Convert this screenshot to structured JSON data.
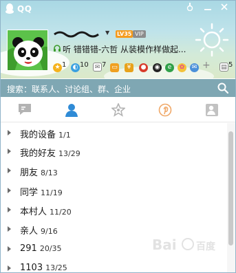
{
  "titlebar": {
    "app_title": "QQ",
    "buttons": [
      "skin",
      "minimize",
      "close"
    ]
  },
  "profile": {
    "nickname": "⁠⁠⁠⁠⁠⁠⁠",
    "level_badge": "LV35",
    "vip_badge": "VIP",
    "signature": "听 错错错-六哲  从装模作样做起..."
  },
  "status_icons": [
    {
      "icon": "star-icon",
      "count": "1",
      "color": "#f5b21c"
    },
    {
      "icon": "qzone-icon",
      "count": "10",
      "color": "#3aa0e0"
    },
    {
      "icon": "mail-icon",
      "count": "7",
      "color": "#8a8a8a"
    },
    {
      "icon": "shop-icon",
      "count": "",
      "color": "#f0a020"
    },
    {
      "icon": "wallet-icon",
      "count": "",
      "color": "#e8a21a"
    },
    {
      "icon": "game-icon",
      "count": "",
      "color": "#d83b2b"
    },
    {
      "icon": "penguin-icon",
      "count": "",
      "color": "#222222"
    },
    {
      "icon": "browser-icon",
      "count": "",
      "color": "#2fa048"
    },
    {
      "icon": "flower-icon",
      "count": "",
      "color": "#e84b8a"
    },
    {
      "icon": "chat-icon",
      "count": "",
      "color": "#4a90d9"
    },
    {
      "icon": "add-icon",
      "count": "",
      "color": "#9a9a9a"
    },
    {
      "icon": "msgbox-icon",
      "count": "5",
      "color": "#8a8a8a"
    }
  ],
  "search": {
    "placeholder": "搜索：联系人、讨论组、群、企业"
  },
  "tabs": [
    {
      "name": "messages",
      "active": false
    },
    {
      "name": "contacts",
      "active": true
    },
    {
      "name": "favorites",
      "active": false
    },
    {
      "name": "pinterest",
      "active": false
    },
    {
      "name": "groups",
      "active": false
    }
  ],
  "groups": [
    {
      "name": "我的设备",
      "count": "1/1"
    },
    {
      "name": "我的好友",
      "count": "13/29"
    },
    {
      "name": "朋友",
      "count": "8/13"
    },
    {
      "name": "同学",
      "count": "11/19"
    },
    {
      "name": "本村人",
      "count": "11/20"
    },
    {
      "name": "亲人",
      "count": "9/16"
    },
    {
      "name": "291",
      "count": "20/35"
    },
    {
      "name": "1103",
      "count": "13/25"
    }
  ],
  "colors": {
    "accent": "#2f8bd6",
    "search_bg": "#6898a6"
  }
}
